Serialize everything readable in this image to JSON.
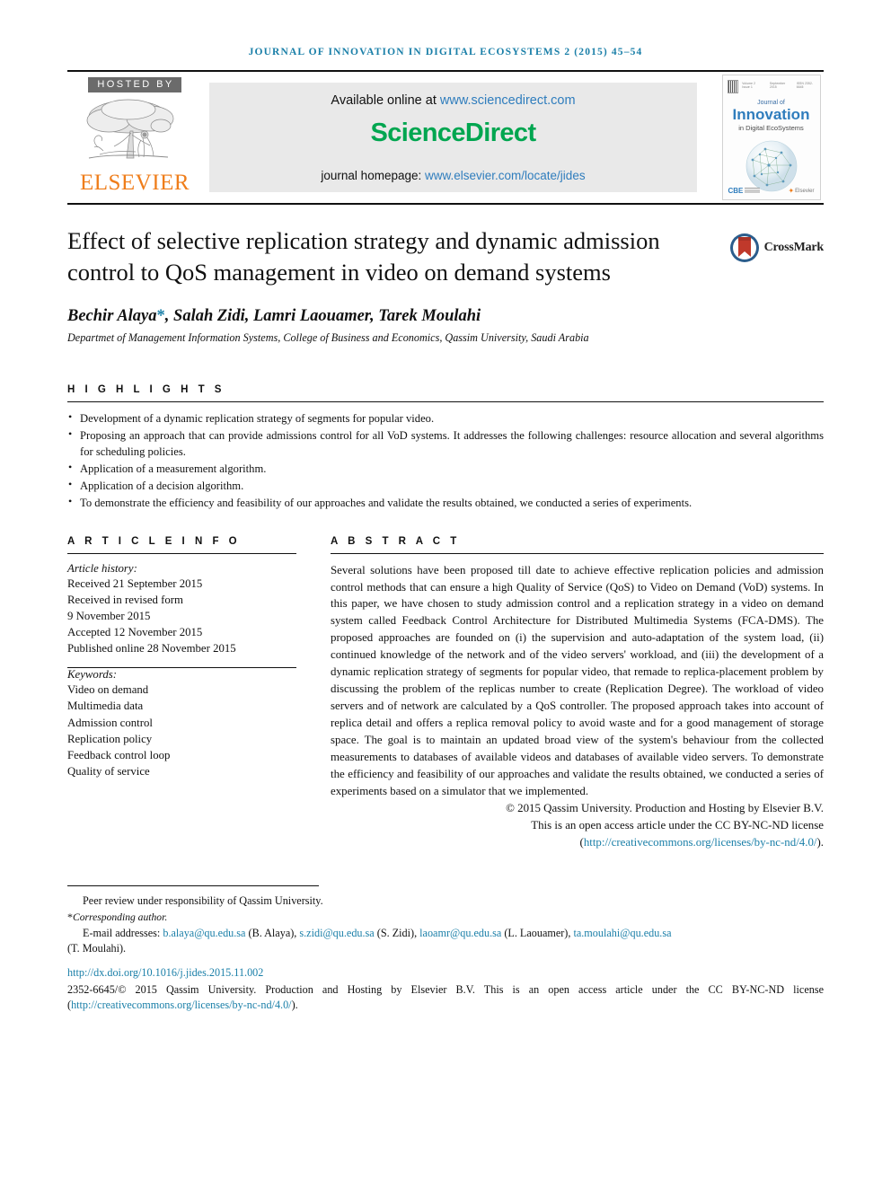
{
  "running_head": "JOURNAL OF INNOVATION IN DIGITAL ECOSYSTEMS 2 (2015) 45–54",
  "masthead": {
    "hosted_by": "HOSTED BY",
    "publisher": "ELSEVIER",
    "available_prefix": "Available online at ",
    "available_url": "www.sciencedirect.com",
    "sciencedirect": "ScienceDirect",
    "homepage_prefix": "journal homepage: ",
    "homepage_url": "www.elsevier.com/locate/jides",
    "cover": {
      "volume_info": "Volume 2  Issue 1",
      "date_info": "September 2015",
      "issn_info": "ISSN 2352-6645",
      "journal_of": "Journal of",
      "innovation": "Innovation",
      "subtitle": "in Digital EcoSystems",
      "cbe": "CBE",
      "cbe_sub": "College of Business\nand Economics",
      "elsevier_small": "Elsevier"
    }
  },
  "article": {
    "title": "Effect of selective replication strategy and dynamic admission control to QoS management in video on demand systems",
    "authors": "Bechir Alaya",
    "authors_rest": ", Salah Zidi, Lamri Laouamer, Tarek Moulahi",
    "corresponding_marker": "*",
    "affiliation": "Departmet of Management Information Systems, College of Business and Economics, Qassim University, Saudi Arabia",
    "crossmark_label": "CrossMark"
  },
  "highlights": {
    "label": "H I G H L I G H T S",
    "items": [
      "Development of a dynamic replication strategy of segments for popular video.",
      "Proposing an approach that can provide admissions control for all VoD systems. It addresses the following challenges: resource allocation and several algorithms for scheduling policies.",
      "Application of a measurement algorithm.",
      "Application of a decision algorithm.",
      "To demonstrate the efficiency and feasibility of our approaches and validate the results obtained, we conducted a series of experiments."
    ]
  },
  "article_info": {
    "label": "A R T I C L E   I N F O",
    "history_title": "Article history:",
    "history": [
      "Received 21 September 2015",
      "Received in revised form",
      "9 November 2015",
      "Accepted 12 November 2015",
      "Published online 28 November 2015"
    ],
    "keywords_title": "Keywords:",
    "keywords": [
      "Video on demand",
      "Multimedia data",
      "Admission control",
      "Replication policy",
      "Feedback control loop",
      "Quality of service"
    ]
  },
  "abstract": {
    "label": "A B S T R A C T",
    "body": "Several solutions have been proposed till date to achieve effective replication policies and admission control methods that can ensure a high Quality of Service (QoS) to Video on Demand (VoD) systems. In this paper, we have chosen to study admission control and a replication strategy in a video on demand system called Feedback Control Architecture for Distributed Multimedia Systems (FCA-DMS). The proposed approaches are founded on (i) the supervision and auto-adaptation of the system load, (ii) continued knowledge of the network and of the video servers' workload, and (iii) the development of a dynamic replication strategy of segments for popular video, that remade to replica-placement problem by discussing the problem of the replicas number to create (Replication Degree). The workload of video servers and of network are calculated by a QoS controller. The proposed approach takes into account of replica detail and offers a replica removal policy to avoid waste and for a good management of storage space. The goal is to maintain an updated broad view of the system's behaviour from the collected measurements to databases of available videos and databases of available video servers. To demonstrate the efficiency and feasibility of our approaches and validate the results obtained, we conducted a series of experiments based on a simulator that we implemented.",
    "copyright_line1": "© 2015 Qassim University. Production and Hosting by Elsevier B.V.",
    "copyright_line2": "This is an open access article under the CC BY-NC-ND license",
    "license_open": "(",
    "license_url": "http://creativecommons.org/licenses/by-nc-nd/4.0/",
    "license_close": ")."
  },
  "footnotes": {
    "peer_review": "Peer review under responsibility of Qassim University.",
    "corresponding_star": "*",
    "corresponding": "Corresponding author.",
    "email_label": "E-mail addresses:",
    "emails": [
      {
        "address": "b.alaya@qu.edu.sa",
        "name": "(B. Alaya)"
      },
      {
        "address": "s.zidi@qu.edu.sa",
        "name": "(S. Zidi)"
      },
      {
        "address": "laoamr@qu.edu.sa",
        "name": "(L. Laouamer)"
      },
      {
        "address": "ta.moulahi@qu.edu.sa",
        "name": "(T. Moulahi)"
      }
    ],
    "email_tail": "(T. Moulahi).",
    "doi": "http://dx.doi.org/10.1016/j.jides.2015.11.002",
    "issn_prefix": "2352-6645/",
    "issn_copy": "© 2015 Qassim University. Production and Hosting by Elsevier B.V. This is an open access article under the CC BY-NC-ND license (",
    "issn_url": "http://creativecommons.org/licenses/by-nc-nd/4.0/",
    "issn_tail": ")."
  },
  "colors": {
    "link_blue": "#1a7fa8",
    "sd_green": "#00a650",
    "elsevier_orange": "#ef7d1a",
    "hosted_gray": "#6b6b6b",
    "panel_gray": "#e9e9e9"
  }
}
